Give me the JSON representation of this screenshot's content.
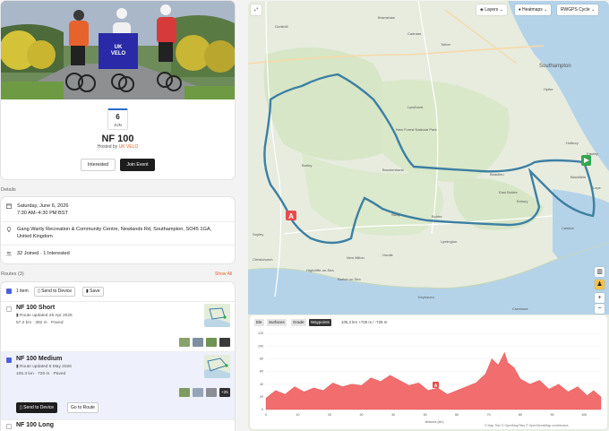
{
  "event": {
    "logo_line1": "UK",
    "logo_line2": "VELO",
    "date_day": "6",
    "date_month": "JUN",
    "title": "NF 100",
    "hosted_prefix": "Hosted by",
    "host": "UK VELO",
    "interested_label": "Interested",
    "join_label": "Join Event"
  },
  "details": {
    "section_label": "Details",
    "date_line1": "Saturday, June 6, 2026",
    "date_line2": "7:30 AM–4:30 PM BST",
    "location": "Gang Warily Recreation & Community Centre, Newlands Rd, Southampton, SO45 1GA, United Kingdom",
    "attendance": "32 Joined · 1 Interested"
  },
  "routes": {
    "section_label": "Routes (3)",
    "show_all": "Show All",
    "selected_count": "1 item",
    "send_label": "Send to Device",
    "save_label": "Save",
    "items": [
      {
        "name": "NF 100 Short",
        "updated": "Route updated 26 Apr 2026",
        "stats": "57.2 km · 382 m · Paved",
        "checked": false
      },
      {
        "name": "NF 100 Medium",
        "updated": "Route updated 6 May 2026",
        "stats": "105.3 km · 726 m · Paved",
        "checked": true,
        "more_photos": "+25",
        "send_label": "Send to Device",
        "goto_label": "Go to Route"
      },
      {
        "name": "NF 100 Long",
        "checked": false
      }
    ]
  },
  "map": {
    "layers_label": "Layers",
    "heatmaps_label": "Heatmaps",
    "style_label": "RWGPS Cycle",
    "places": [
      "Bramshaw",
      "Godshill",
      "Cadnam",
      "Totton",
      "Southampton",
      "Lyndhurst",
      "New Forest National Park",
      "Bransgore",
      "Burley",
      "Brockenhurst",
      "Beaulieu",
      "Blackfield",
      "Fawley",
      "Holbury",
      "Lepe",
      "East Boldre",
      "Sway",
      "Boldre",
      "Lymington",
      "Bransgore",
      "Sopley",
      "Hordle",
      "New Milton",
      "Barton on Sea",
      "Highcliffe-on-Sea",
      "Christchurch",
      "Keyhaven",
      "Hythe",
      "Exbury",
      "Calshot",
      "Cranmore",
      "Ringwood",
      "Ibsley",
      "Rockford",
      "Ellingham",
      "Picket Post",
      "Bank",
      "Dibden",
      "Marchwood",
      "Ashurst",
      "Pilley",
      "Wootton",
      "Tiptoe",
      "Everton"
    ],
    "attribution": "© Map Tiler © OpenMapTiles © OpenStreetMap contributors"
  },
  "elevation": {
    "tabs": [
      "Ele",
      "Surfaces",
      "Grade",
      "Waypoints"
    ],
    "active_tab": "Waypoints",
    "summary": "105.3 km +726 m / -726 m",
    "y_ticks": [
      "120",
      "100",
      "80",
      "60",
      "40",
      "20",
      "0"
    ],
    "x_ticks": [
      "0",
      "10",
      "20",
      "30",
      "40",
      "50",
      "60",
      "70",
      "80",
      "90",
      "100"
    ],
    "x_unit": "km",
    "y_unit": "m",
    "x_label": "distance (km)",
    "marker": "A"
  },
  "colors": {
    "accent": "#e2612a",
    "route": "#3d7fa3",
    "elevation_fill": "#f26d6d",
    "start_marker": "#e94b4b",
    "end_marker": "#2fa84f",
    "checkbox": "#4a62d8"
  }
}
